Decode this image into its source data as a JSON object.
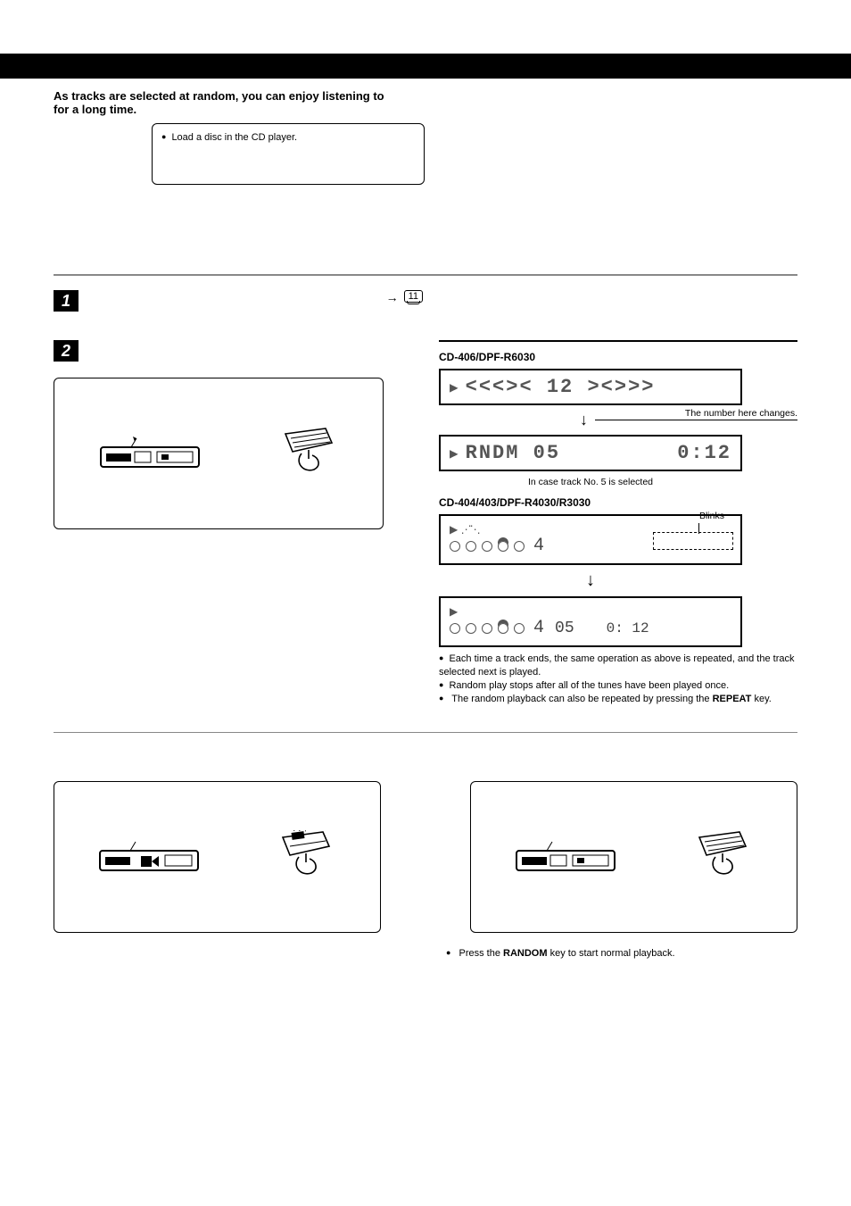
{
  "intro_line1": "As tracks are selected at random, you can enjoy listening to",
  "intro_line2": "for a long time.",
  "prep_note": "Load a disc in the CD player.",
  "page_ref_arrow": "→",
  "page_ref": "11",
  "model_a": "CD-406/DPF-R6030",
  "lcd_a1": "<<<><   12   ><>>>",
  "annot_a1": "The number here changes.",
  "lcd_a2_left": "RNDM 05",
  "lcd_a2_right": "0:12",
  "caption_a2": "In case track No. 5 is selected",
  "model_b": "CD-404/403/DPF-R4030/R3030",
  "annot_b_blinks": "Blinks",
  "lcd_b1_digits": "4",
  "lcd_b2_track": "05",
  "lcd_b2_time": "0: 12",
  "notes": {
    "n1": "Each time a track ends, the same operation as above is repeated, and the track selected next is played.",
    "n2": "Random play stops after all of the tunes have been played once.",
    "n3_a": "The random playback can also be repeated by pressing the ",
    "n3_b": "REPEAT",
    "n3_c": " key."
  },
  "bottom_note_a": "Press the ",
  "bottom_note_b": "RANDOM",
  "bottom_note_c": " key to start normal playback.",
  "icons": {
    "panel": "front-panel",
    "remote": "remote-control",
    "skipbtn": "skip-next"
  }
}
